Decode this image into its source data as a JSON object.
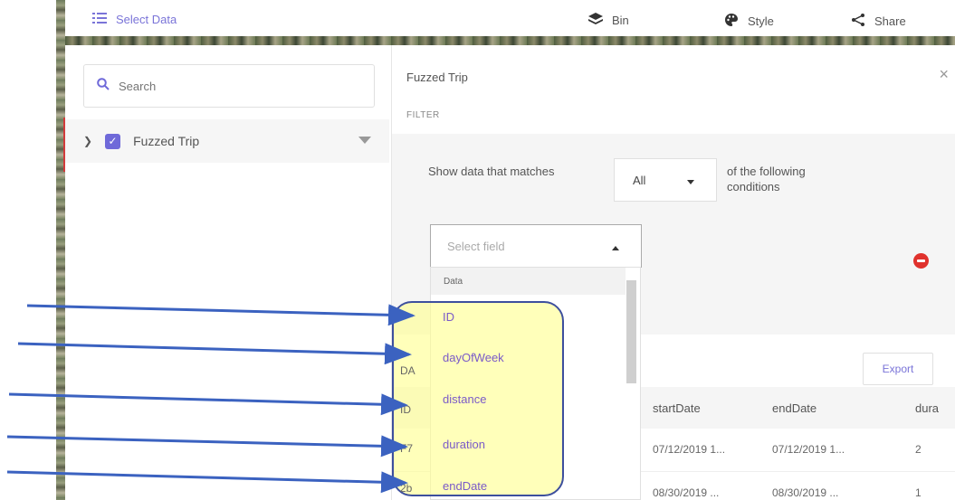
{
  "toolbar": {
    "select_data": "Select Data",
    "bin": "Bin",
    "style": "Style",
    "share": "Share"
  },
  "sidebar": {
    "search_placeholder": "Search",
    "layer_name": "Fuzzed Trip"
  },
  "panel": {
    "title": "Fuzzed Trip",
    "section": "FILTER",
    "show_text": "Show data that matches",
    "match_value": "All",
    "conditions_text": "of the following conditions",
    "field_placeholder": "Select field"
  },
  "dropdown": {
    "group": "Data",
    "items": [
      "ID",
      "dayOfWeek",
      "distance",
      "duration",
      "endDate"
    ]
  },
  "table": {
    "export_label": "Export",
    "columns": [
      "startDate",
      "endDate",
      "dura"
    ],
    "row_prefixes": [
      "DA",
      "ID",
      "F7",
      "2b"
    ],
    "rows": [
      [
        "07/12/2019 1...",
        "07/12/2019 1...",
        "2"
      ],
      [
        "08/30/2019 ...",
        "08/30/2019 ...",
        "1"
      ]
    ]
  },
  "colors": {
    "accent": "#7a74d8",
    "highlight_fill": "#ffff8c",
    "highlight_border": "#3d4f9d",
    "arrow": "#3b62c0",
    "remove": "#e0322d"
  }
}
